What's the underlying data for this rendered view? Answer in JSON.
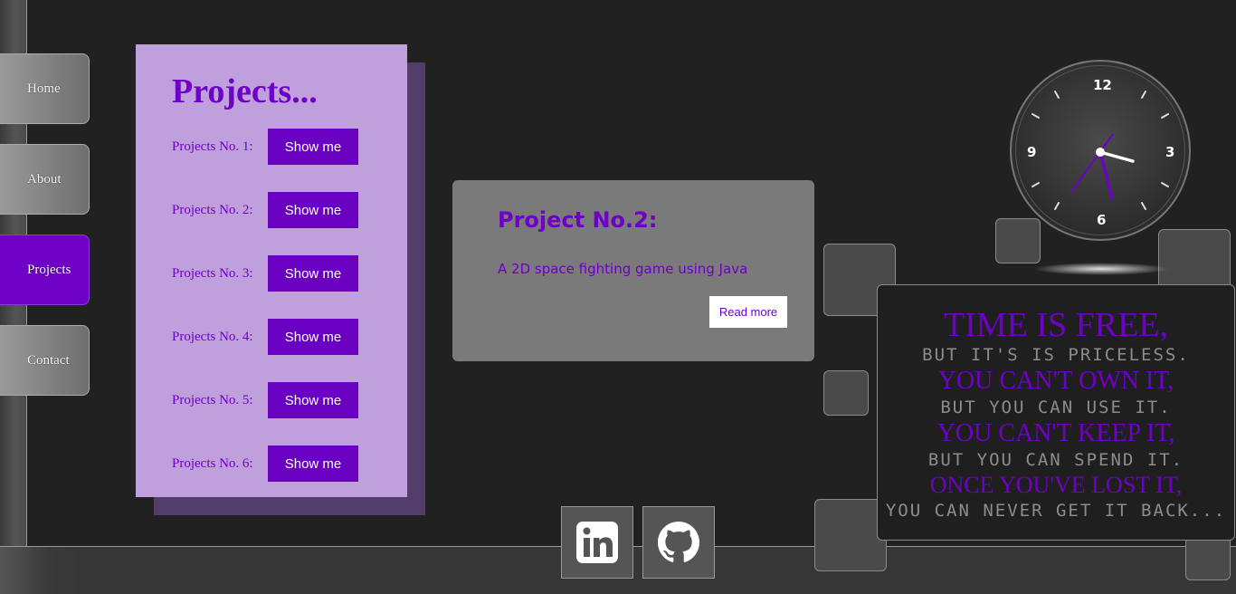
{
  "nav": {
    "items": [
      {
        "label": "Home"
      },
      {
        "label": "About"
      },
      {
        "label": "Projects",
        "active": true
      },
      {
        "label": "Contact"
      }
    ]
  },
  "projects": {
    "title": "Projects...",
    "rows": [
      {
        "label": "Projects No. 1:",
        "button": "Show me"
      },
      {
        "label": "Projects No. 2:",
        "button": "Show me"
      },
      {
        "label": "Projects No. 3:",
        "button": "Show me"
      },
      {
        "label": "Projects No. 4:",
        "button": "Show me"
      },
      {
        "label": "Projects No. 5:",
        "button": "Show me"
      },
      {
        "label": "Projects No. 6:",
        "button": "Show me"
      }
    ]
  },
  "card": {
    "title": "Project No.2:",
    "description": "A 2D space fighting game using Java",
    "read_more": "Read more"
  },
  "clock": {
    "numbers": {
      "twelve": "12",
      "three": "3",
      "six": "6",
      "nine": "9"
    },
    "time": "3:22:39"
  },
  "quote": {
    "lines": [
      "TIME IS FREE,",
      "BUT IT'S IS PRICELESS.",
      "YOU CAN'T OWN IT,",
      "BUT YOU CAN USE IT.",
      "YOU CAN'T KEEP IT,",
      "BUT YOU CAN SPEND IT.",
      "ONCE YOU'VE LOST IT,",
      "YOU CAN NEVER GET IT BACK..."
    ]
  },
  "social": {
    "linkedin_icon": "linkedin-icon",
    "github_icon": "github-icon"
  },
  "colors": {
    "accent": "#6f00c6",
    "panel": "#bfa0dc",
    "background": "#212121"
  }
}
